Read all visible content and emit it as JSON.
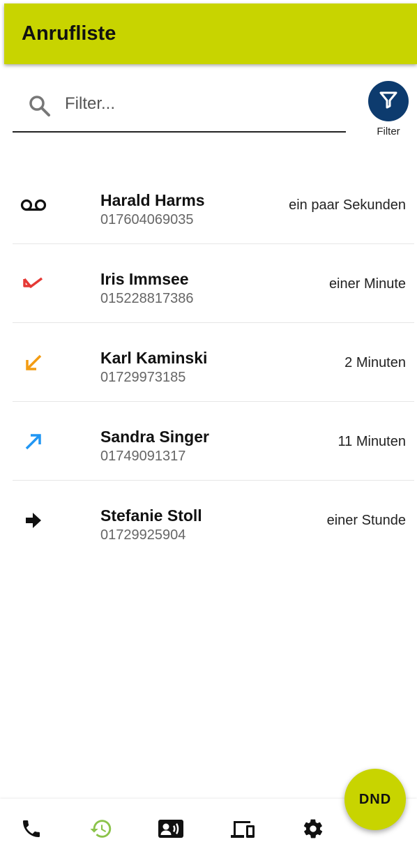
{
  "appbar": {
    "title": "Anrufliste",
    "color": "#c8d400"
  },
  "search": {
    "placeholder": "Filter...",
    "value": ""
  },
  "filter": {
    "label": "Filter",
    "color": "#0d3b6e"
  },
  "calls": [
    {
      "icon": "voicemail-icon",
      "name": "Harald Harms",
      "number": "017604069035",
      "time": "ein paar Sekunden"
    },
    {
      "icon": "missed-call-icon",
      "name": "Iris Immsee",
      "number": "015228817386",
      "time": "einer Minute",
      "color": "#e53935"
    },
    {
      "icon": "incoming-call-icon",
      "name": "Karl Kaminski",
      "number": "01729973185",
      "time": "2 Minuten",
      "color": "#f39c12"
    },
    {
      "icon": "outgoing-call-icon",
      "name": "Sandra Singer",
      "number": "01749091317",
      "time": "11 Minuten",
      "color": "#2196f3"
    },
    {
      "icon": "forwarded-call-icon",
      "name": "Stefanie Stoll",
      "number": "01729925904",
      "time": "einer Stunde"
    }
  ],
  "dnd": {
    "label": "DND"
  },
  "nav": {
    "items": [
      "phone-icon",
      "history-icon",
      "contacts-icon",
      "devices-icon",
      "settings-icon"
    ],
    "active": "history-icon",
    "active_color": "#8bc34a"
  }
}
